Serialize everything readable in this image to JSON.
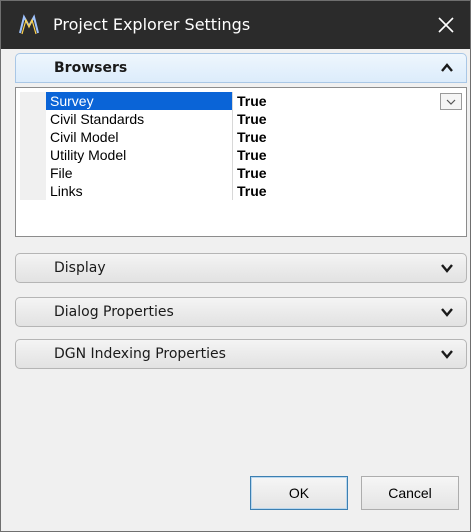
{
  "window": {
    "title": "Project Explorer Settings",
    "app_icon": "microstation-icon",
    "close_icon": "close-icon"
  },
  "browsers_section": {
    "label": "Browsers",
    "state": "expanded",
    "chevron_icon": "chevron-up-icon"
  },
  "browsers_grid": {
    "rows": [
      {
        "name": "Survey",
        "value": "True",
        "selected": true
      },
      {
        "name": "Civil Standards",
        "value": "True"
      },
      {
        "name": "Civil Model",
        "value": "True"
      },
      {
        "name": "Utility Model",
        "value": "True"
      },
      {
        "name": "File",
        "value": "True"
      },
      {
        "name": "Links",
        "value": "True"
      }
    ],
    "dropdown_icon": "chevron-down-icon"
  },
  "collapsed_sections": [
    {
      "label": "Display",
      "chevron_icon": "chevron-down-icon"
    },
    {
      "label": "Dialog Properties",
      "chevron_icon": "chevron-down-icon"
    },
    {
      "label": "DGN Indexing Properties",
      "chevron_icon": "chevron-down-icon"
    }
  ],
  "buttons": {
    "ok_label": "OK",
    "cancel_label": "Cancel"
  },
  "colors": {
    "titlebar": "#2b2b2b",
    "selection": "#0a64d7",
    "section_open": "#dcecfb",
    "window_bg": "#f0f0f0"
  }
}
